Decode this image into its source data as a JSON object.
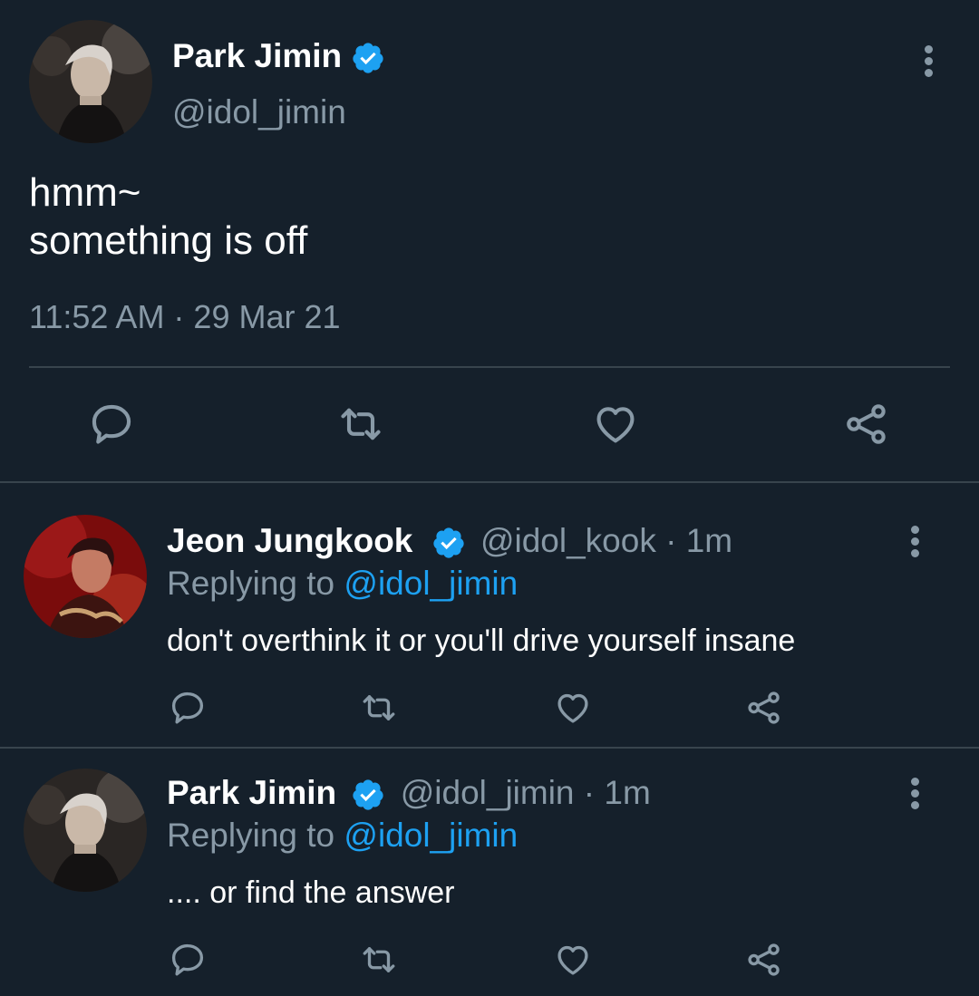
{
  "colors": {
    "background": "#15202b",
    "secondary_text": "#8899a6",
    "accent": "#1da1f2",
    "divider": "#38444d"
  },
  "main_tweet": {
    "author_name": "Park Jimin",
    "author_handle": "@idol_jimin",
    "text_lines": [
      "hmm~",
      "something is off"
    ],
    "timestamp": "11:52 AM · 29 Mar 21",
    "actions": [
      "reply-icon",
      "retweet-icon",
      "like-icon",
      "share-icon"
    ]
  },
  "replies": [
    {
      "author_name": "Jeon Jungkook",
      "author_handle": "@idol_kook · 1m",
      "replying_prefix": "Replying to ",
      "replying_mention": "@idol_jimin",
      "text": "don't overthink it or you'll drive yourself insane"
    },
    {
      "author_name": "Park Jimin",
      "author_handle": "@idol_jimin · 1m",
      "replying_prefix": "Replying to ",
      "replying_mention": "@idol_jimin",
      "text": ".... or find the answer"
    }
  ]
}
